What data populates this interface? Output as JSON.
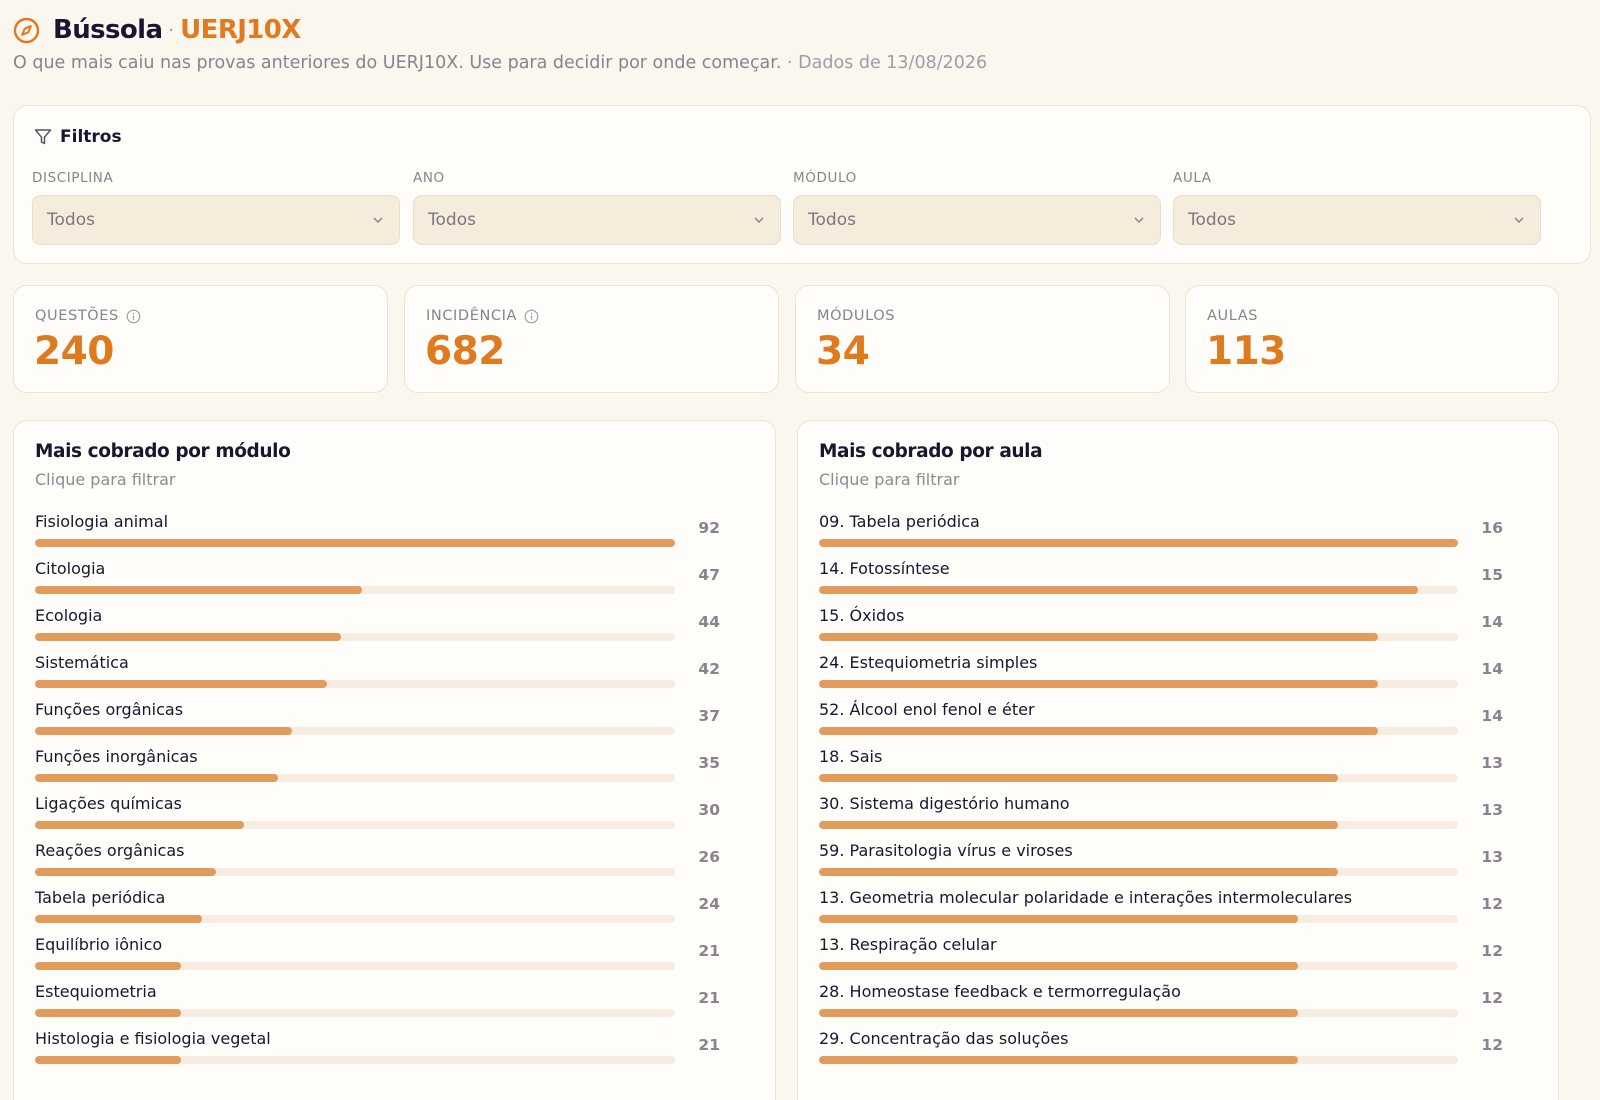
{
  "header": {
    "title": "Bússola",
    "separator": "·",
    "brand": "UERJ10X",
    "subtitle": "O que mais caiu nas provas anteriores do UERJ10X. Use para decidir por onde começar.",
    "date_text": "· Dados de 13/08/2026"
  },
  "filters": {
    "title": "Filtros",
    "items": [
      {
        "label": "DISCIPLINA",
        "value": "Todos"
      },
      {
        "label": "ANO",
        "value": "Todos"
      },
      {
        "label": "MÓDULO",
        "value": "Todos"
      },
      {
        "label": "AULA",
        "value": "Todos"
      }
    ]
  },
  "stats": [
    {
      "label": "QUESTÕES",
      "value": "240",
      "has_info": true
    },
    {
      "label": "INCIDÊNCIA",
      "value": "682",
      "has_info": true
    },
    {
      "label": "MÓDULOS",
      "value": "34",
      "has_info": false
    },
    {
      "label": "AULAS",
      "value": "113",
      "has_info": false
    }
  ],
  "colors": {
    "accent": "#e07a1f",
    "bar_fill": "#e39b5c",
    "bar_track": "#f6ecdf",
    "background": "#fbf6ee"
  },
  "modules_panel": {
    "title": "Mais cobrado por módulo",
    "subtitle": "Clique para filtrar",
    "max": 92,
    "items": [
      {
        "label": "Fisiologia animal",
        "value": 92
      },
      {
        "label": "Citologia",
        "value": 47
      },
      {
        "label": "Ecologia",
        "value": 44
      },
      {
        "label": "Sistemática",
        "value": 42
      },
      {
        "label": "Funções orgânicas",
        "value": 37
      },
      {
        "label": "Funções inorgânicas",
        "value": 35
      },
      {
        "label": "Ligações químicas",
        "value": 30
      },
      {
        "label": "Reações orgânicas",
        "value": 26
      },
      {
        "label": "Tabela periódica",
        "value": 24
      },
      {
        "label": "Equilíbrio iônico",
        "value": 21
      },
      {
        "label": "Estequiometria",
        "value": 21
      },
      {
        "label": "Histologia e fisiologia vegetal",
        "value": 21
      }
    ]
  },
  "lessons_panel": {
    "title": "Mais cobrado por aula",
    "subtitle": "Clique para filtrar",
    "max": 16,
    "items": [
      {
        "label": "09. Tabela periódica",
        "value": 16
      },
      {
        "label": "14. Fotossíntese",
        "value": 15
      },
      {
        "label": "15. Óxidos",
        "value": 14
      },
      {
        "label": "24. Estequiometria simples",
        "value": 14
      },
      {
        "label": "52. Álcool enol fenol e éter",
        "value": 14
      },
      {
        "label": "18. Sais",
        "value": 13
      },
      {
        "label": "30. Sistema digestório humano",
        "value": 13
      },
      {
        "label": "59. Parasitologia vírus e viroses",
        "value": 13
      },
      {
        "label": "13. Geometria molecular polaridade e interações intermoleculares",
        "value": 12
      },
      {
        "label": "13. Respiração celular",
        "value": 12
      },
      {
        "label": "28. Homeostase feedback e termorregulação",
        "value": 12
      },
      {
        "label": "29. Concentração das soluções",
        "value": 12
      }
    ]
  }
}
